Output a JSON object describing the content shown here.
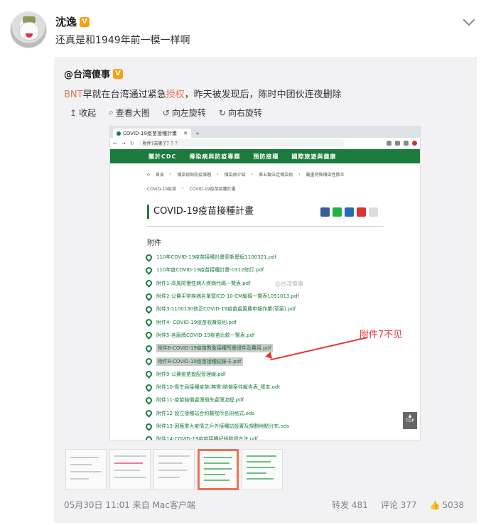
{
  "post": {
    "author": "沈逸",
    "text": "还真是和1949年前一模一样啊"
  },
  "repost": {
    "author": "@台湾傻事",
    "text_parts": [
      "",
      "BNT",
      "早就在台湾通过紧急",
      "授权",
      "，昨天被发现后，陈时中团伙连夜删除"
    ],
    "actions": {
      "collapse": "收起",
      "view_large": "查看大图",
      "rotate_left": "向左旋转",
      "rotate_right": "向右旋转"
    },
    "screenshot": {
      "tab_title": "COVID-19疫苗接種計畫",
      "url": "附件7去哪了？？？",
      "nav": [
        "關於CDC",
        "傳染病與防疫專題",
        "預防接種",
        "國際旅遊與健康"
      ],
      "breadcrumbs": [
        "首頁",
        "傳染病與防疫專題",
        "傳染病介紹",
        "第五類法定傳染病",
        "嚴重特殊傳染性肺炎"
      ],
      "breadcrumbs2": [
        "COVID-19疫苗",
        "COVID-19疫苗接種計畫"
      ],
      "page_title": "COVID-19疫苗接種計畫",
      "attachments_heading": "附件",
      "files": [
        "110年COVID-19疫苗接種計畫更新歷程1100321.pdf",
        "110年度COVID-19疫苗接種計畫-0312修訂.pdf",
        "附件1-高風險慢性病人疾病代碼一覽表.pdf",
        "附件2-公費平常疾病名單暨ICD-10-CM編碼一覽表1091013.pdf",
        "附件3-1100130修正COVID-19疫苗處置費申報作業(草案).pdf",
        "附件4- COVID-19疫苗收費原則.pdf",
        "附件5-各廠牌COVID-19疫苗比較一覽表.pdf",
        "附件6-COVID-19疫苗對象接種所需證件及費用.pdf",
        "附件8-COVID-19疫苗接種紀錄卡.pdf",
        "附件9-公費疫苗撥配管理線.pdf",
        "附件10-衛生局接種疫苗(無需)賠償案件報告表_樣本.odt",
        "附件11-疫苗賠償處理損失處理流程.pdf",
        "附件12-設立接種站合約醫院所名冊格式.ods",
        "附件13-因應重大疫情之戶外接種站設置及規劃地點分布.ods",
        "附件14-COVID-19疫苗接種紀錄驗證方法.pdf"
      ],
      "annotation": "附件7不见",
      "watermark": "@台湾傻事",
      "top_label": "TOP"
    }
  },
  "meta": {
    "date": "05月30日 11:01",
    "source": "来自 Mac客户端"
  },
  "stats": {
    "repost": "转发 481",
    "comment": "评论 377",
    "like": "5038"
  }
}
